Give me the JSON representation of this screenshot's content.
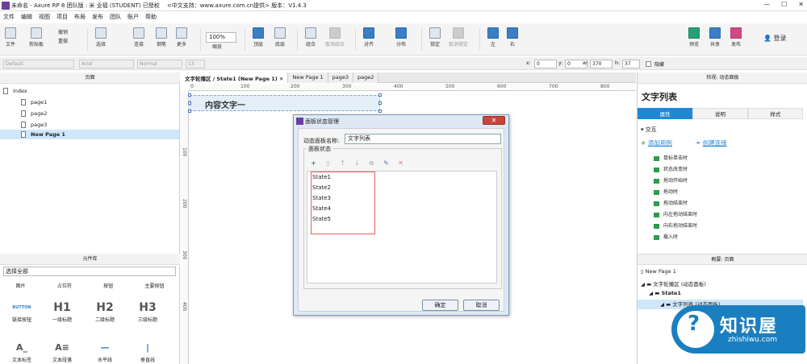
{
  "window": {
    "title": "未命名 - Axure RP 8 团队版 : 米 业福 (STUDENT) 已授权 　<中文支持：www.axure.com.cn提供> 版本：V1.4.3",
    "controls": [
      "—",
      "☐",
      "✕"
    ]
  },
  "menu": [
    "文件",
    "编辑",
    "视图",
    "项目",
    "布局",
    "发布",
    "团队",
    "账户",
    "帮助"
  ],
  "toolbar": {
    "file": "文件",
    "clipboard": "剪贴板",
    "undo": "撤销",
    "redo": "重做",
    "select": "选择",
    "connect": "连接",
    "pen": "钢笔",
    "more": "更多",
    "zoom_value": "100%",
    "zoom_label": "缩放",
    "top_layer": "顶层",
    "bottom_layer": "底层",
    "group": "组合",
    "ungroup": "取消组合",
    "align": "对齐",
    "distribute": "分布",
    "lock": "锁定",
    "unlock": "取消锁定",
    "left": "左",
    "right": "右",
    "preview": "预览",
    "share": "共享",
    "publish": "发布",
    "login": "登录"
  },
  "format": {
    "style": "Default",
    "font": "Arial",
    "weight": "Normal",
    "size": "13",
    "x_label": "x:",
    "x_value": "0",
    "y_label": "y:",
    "y_value": "0",
    "w_label": "w:",
    "w_value": "370",
    "h_label": "h:",
    "h_value": "37",
    "hidden_label": "隐藏"
  },
  "pages_panel": {
    "title": "页面",
    "items": [
      {
        "label": "index",
        "level": 0
      },
      {
        "label": "page1",
        "level": 1
      },
      {
        "label": "page2",
        "level": 1
      },
      {
        "label": "page3",
        "level": 1
      },
      {
        "label": "New Page 1",
        "level": 1,
        "selected": true
      }
    ]
  },
  "library_panel": {
    "title": "元件库",
    "filter": "选择全部",
    "header_labels": [
      "图片",
      "占位符",
      "按钮",
      "主要按钮"
    ],
    "items": [
      {
        "icon_text": "BUTTON",
        "label": "链接按钮"
      },
      {
        "icon_text": "H1",
        "label": "一级标题"
      },
      {
        "icon_text": "H2",
        "label": "二级标题"
      },
      {
        "icon_text": "H3",
        "label": "三级标题"
      },
      {
        "icon_text": "A_",
        "label": "文本标签"
      },
      {
        "icon_text": "A≡",
        "label": "文本段落"
      },
      {
        "icon_text": "—",
        "label": "水平线"
      },
      {
        "icon_text": "|",
        "label": "垂直线"
      }
    ]
  },
  "tabs": [
    "文字轮播区 / State1 (New Page 1)",
    "New Page 1",
    "page3",
    "page2"
  ],
  "tab_close": "✕",
  "ruler": {
    "h_ticks": [
      "0",
      "100",
      "200",
      "300",
      "400",
      "500",
      "600",
      "700",
      "800"
    ],
    "v_ticks": [
      "100",
      "200",
      "300",
      "400"
    ]
  },
  "canvas_widget_text": "内容文字一",
  "dialog": {
    "title": "面板状态管理",
    "close": "✕",
    "name_label": "动态面板名称:",
    "name_value": "文字列表",
    "group_label": "面板状态",
    "tools": [
      "+",
      "▯",
      "↑",
      "↓",
      "⧉",
      "✎",
      "✕"
    ],
    "states": [
      "State1",
      "State2",
      "State3",
      "State4",
      "State5"
    ],
    "ok": "确定",
    "cancel": "取消"
  },
  "inspector": {
    "header": "检视: 动态面板",
    "name": "文字列表",
    "tabs": [
      "属性",
      "说明",
      "样式"
    ],
    "interaction_title": "交互",
    "add_case": "添加用例",
    "create_link": "创建连接",
    "events": [
      "鼠标单击时",
      "状态改变时",
      "拖动开始时",
      "拖动时",
      "拖动结束时",
      "向左拖动结束时",
      "向右拖动结束时",
      "载入时"
    ]
  },
  "outline": {
    "header": "概要: 页面",
    "items": [
      {
        "label": "New Page 1",
        "level": 0
      },
      {
        "label": "文字轮播区 (动态面板)",
        "level": 1
      },
      {
        "label": "State1",
        "level": 2
      },
      {
        "label": "文字列表 (动态面板)",
        "level": 3,
        "selected": true
      }
    ]
  },
  "brand": {
    "name": "知识屋",
    "domain": "zhishiwu.com",
    "mark": "?"
  },
  "colors": {
    "accent": "#1e88d6",
    "selection": "#cfe7fb",
    "highlight_box": "#e06060"
  }
}
